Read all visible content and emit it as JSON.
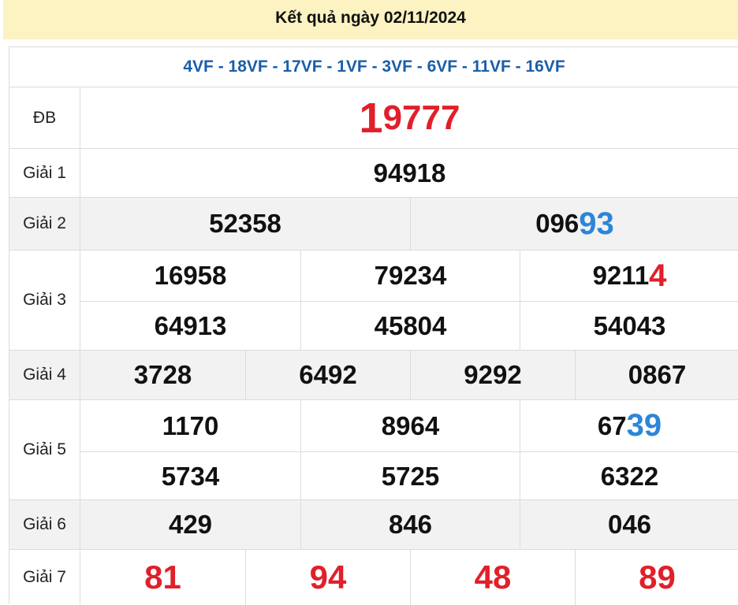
{
  "header": {
    "title": "Kết quả ngày 02/11/2024"
  },
  "codes": "4VF - 18VF - 17VF - 1VF - 3VF - 6VF - 11VF - 16VF",
  "prizes": {
    "db": {
      "label": "ĐB",
      "first": "1",
      "rest": "9777"
    },
    "g1": {
      "label": "Giải 1",
      "value": "94918"
    },
    "g2": {
      "label": "Giải 2",
      "v1": "52358",
      "v2_head": "096",
      "v2_tail": "93"
    },
    "g3": {
      "label": "Giải 3",
      "r1": [
        "16958",
        "79234"
      ],
      "r1c3_head": "9211",
      "r1c3_tail": "4",
      "r2": [
        "64913",
        "45804",
        "54043"
      ]
    },
    "g4": {
      "label": "Giải 4",
      "values": [
        "3728",
        "6492",
        "9292",
        "0867"
      ]
    },
    "g5": {
      "label": "Giải 5",
      "r1": [
        "1170",
        "8964"
      ],
      "r1c3_head": "67",
      "r1c3_tail": "39",
      "r2": [
        "5734",
        "5725",
        "6322"
      ]
    },
    "g6": {
      "label": "Giải 6",
      "values": [
        "429",
        "846",
        "046"
      ]
    },
    "g7": {
      "label": "Giải 7",
      "values": [
        "81",
        "94",
        "48",
        "89"
      ]
    }
  },
  "colors": {
    "header_bg": "#fcf2c2",
    "codes": "#1a5ea8",
    "highlight_red": "#e0202a",
    "highlight_blue": "#2b86d8",
    "row_alt": "#f2f2f2"
  }
}
